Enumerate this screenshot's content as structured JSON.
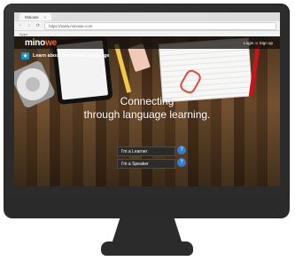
{
  "browser": {
    "tab_title": "Minowe",
    "tab_close": "×",
    "url": "https://www.minowe.com",
    "apps_label": "Apps",
    "nav_back": "‹",
    "nav_forward": "›",
    "nav_reload": "⟳"
  },
  "site": {
    "brand_prefix": "mino",
    "brand_accent": "we",
    "auth": {
      "login": "Login",
      "or": "or",
      "signup": "Sign up"
    },
    "learn_about": "Learn about the Ojibwe language",
    "hero": {
      "line1": "Connecting",
      "line2": "through language learning."
    },
    "cta": {
      "learner": "I'm a Learner",
      "speaker": "I'm a Speaker",
      "help": "?"
    }
  },
  "colors": {
    "brand_orange": "#f26b2b",
    "cta_bg": "#2b2b2b",
    "help_blue": "#2f7fd2",
    "info_blue": "#1e90c9"
  },
  "icons": {
    "learn_icon": "globe-icon",
    "help_icon": "question-icon"
  }
}
